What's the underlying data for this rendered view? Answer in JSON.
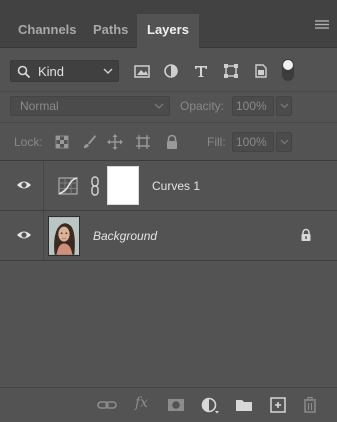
{
  "tabs": [
    {
      "label": "Channels",
      "active": false
    },
    {
      "label": "Paths",
      "active": false
    },
    {
      "label": "Layers",
      "active": true
    }
  ],
  "filter": {
    "kind_label": "Kind",
    "filter_icons": [
      "pixel-layer-filter-icon",
      "adjustment-layer-filter-icon",
      "type-layer-filter-icon",
      "shape-layer-filter-icon",
      "smart-object-filter-icon",
      "filter-toggle-icon"
    ]
  },
  "blend": {
    "mode": "Normal",
    "opacity_label": "Opacity:",
    "opacity_value": "100%"
  },
  "lock": {
    "label": "Lock:",
    "fill_label": "Fill:",
    "fill_value": "100%",
    "lock_icons": [
      "lock-transparent-pixels-icon",
      "lock-image-pixels-icon",
      "lock-position-icon",
      "prevent-autonest-icon",
      "lock-all-icon"
    ]
  },
  "layers": [
    {
      "name": "Curves 1",
      "visible": true,
      "type": "adjustment"
    },
    {
      "name": "Background",
      "visible": true,
      "type": "background",
      "locked": true
    }
  ],
  "bottom_icons": [
    "link-layers-icon",
    "fx-icon",
    "layer-mask-icon",
    "new-fill-adjustment-icon",
    "new-group-icon",
    "new-layer-icon",
    "delete-layer-icon"
  ],
  "colors": {
    "panel_bg": "#535353",
    "tabbar_bg": "#424242",
    "text": "#e4e4e4",
    "muted_text": "#888888"
  }
}
